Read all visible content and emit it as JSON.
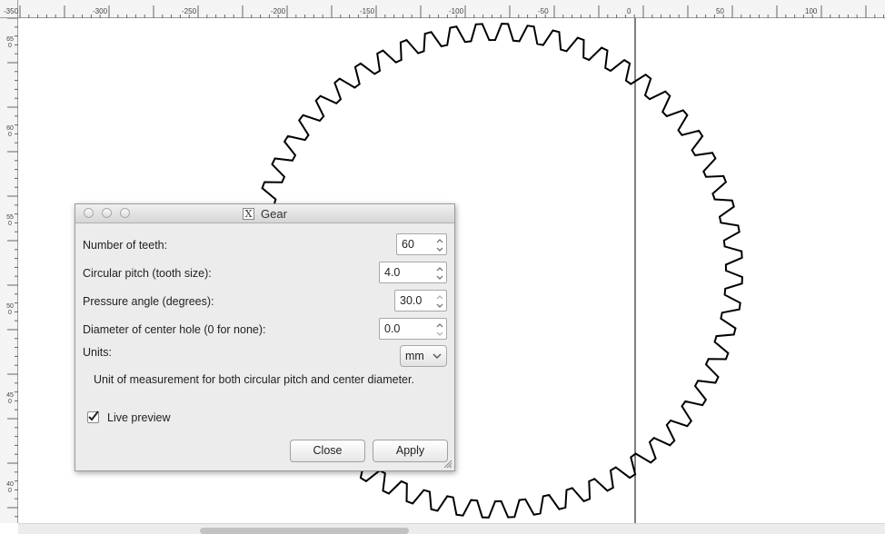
{
  "ruler": {
    "h_labels": [
      "-350",
      "-300",
      "-250",
      "-200",
      "-150",
      "-100",
      "-50",
      "0",
      "50",
      "100"
    ],
    "v_labels": [
      "650",
      "600",
      "550",
      "500",
      "450",
      "400"
    ]
  },
  "dialog": {
    "title": "Gear",
    "title_icon": "x11-icon",
    "fields": [
      {
        "label": "Number of teeth:",
        "value": "60"
      },
      {
        "label": "Circular pitch (tooth size):",
        "value": "4.0"
      },
      {
        "label": "Pressure angle (degrees):",
        "value": "30.0"
      },
      {
        "label": "Diameter of center hole (0 for none):",
        "value": "0.0"
      }
    ],
    "units": {
      "label": "Units:",
      "value": "mm"
    },
    "units_help": "Unit of measurement for both circular pitch and center diameter.",
    "live_preview": {
      "label": "Live preview",
      "checked": true
    },
    "buttons": {
      "close": "Close",
      "apply": "Apply"
    }
  },
  "canvas": {
    "gear_teeth": 60,
    "guide_color": "#000000"
  }
}
